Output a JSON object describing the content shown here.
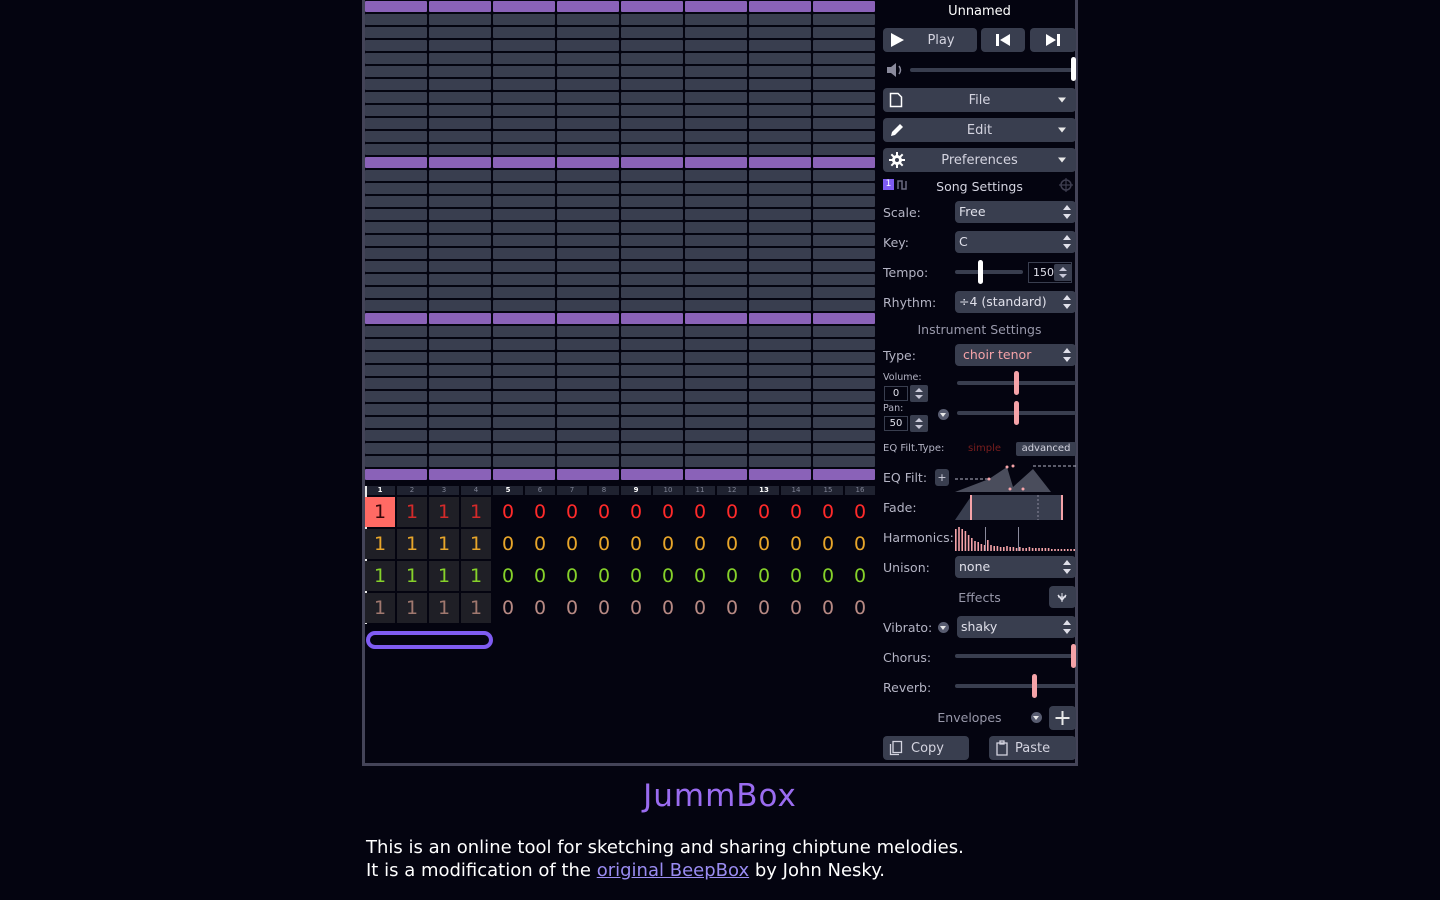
{
  "song": {
    "title": "Unnamed"
  },
  "transport": {
    "play_label": "Play",
    "volume": 1.0
  },
  "menus": {
    "file_label": "File",
    "edit_label": "Edit",
    "preferences_label": "Preferences"
  },
  "song_settings": {
    "heading": "Song Settings",
    "channel_number": "1",
    "scale_label": "Scale:",
    "scale_value": "Free",
    "key_label": "Key:",
    "key_value": "C",
    "tempo_label": "Tempo:",
    "tempo_value": "150",
    "tempo_level": 0.22,
    "rhythm_label": "Rhythm:",
    "rhythm_value": "÷4 (standard)"
  },
  "instrument_settings": {
    "heading": "Instrument Settings",
    "type_label": "Type:",
    "type_value": "choir tenor",
    "volume_label": "Volume:",
    "volume_value": "0",
    "volume_level": 0.5,
    "pan_label": "Pan:",
    "pan_value": "50",
    "pan_level": 0.5,
    "eq_type_label": "EQ Filt.Type:",
    "eq_type_simple": "simple",
    "eq_type_advanced": "advanced",
    "eq_filt_label": "EQ Filt:",
    "eq_add_label": "+",
    "fade_label": "Fade:",
    "harmonics_label": "Harmonics:",
    "unison_label": "Unison:",
    "unison_value": "none",
    "effects_heading": "Effects",
    "vibrato_label": "Vibrato:",
    "vibrato_value": "shaky",
    "chorus_label": "Chorus:",
    "chorus_level": 1.0,
    "reverb_label": "Reverb:",
    "reverb_level": 0.66,
    "envelopes_heading": "Envelopes",
    "copy_label": "Copy",
    "paste_label": "Paste"
  },
  "ruler": {
    "bars": [
      "1",
      "2",
      "3",
      "4",
      "5",
      "6",
      "7",
      "8",
      "9",
      "10",
      "11",
      "12",
      "13",
      "14",
      "15",
      "16"
    ],
    "major": [
      "1",
      "5",
      "9",
      "13"
    ]
  },
  "patterns": {
    "channels": [
      {
        "color": "#ff2a2a",
        "dim": "#8f1b1b",
        "cells": [
          "1",
          "1",
          "1",
          "1",
          "0",
          "0",
          "0",
          "0",
          "0",
          "0",
          "0",
          "0",
          "0",
          "0",
          "0",
          "0"
        ]
      },
      {
        "color": "#e8a62a",
        "dim": "#8a6520",
        "cells": [
          "1",
          "1",
          "1",
          "1",
          "0",
          "0",
          "0",
          "0",
          "0",
          "0",
          "0",
          "0",
          "0",
          "0",
          "0",
          "0"
        ]
      },
      {
        "color": "#86d22a",
        "dim": "#4f7f1d",
        "cells": [
          "1",
          "1",
          "1",
          "1",
          "0",
          "0",
          "0",
          "0",
          "0",
          "0",
          "0",
          "0",
          "0",
          "0",
          "0",
          "0"
        ]
      },
      {
        "color": "#b88a84",
        "dim": "#6e5552",
        "cells": [
          "1",
          "1",
          "1",
          "1",
          "0",
          "0",
          "0",
          "0",
          "0",
          "0",
          "0",
          "0",
          "0",
          "0",
          "0",
          "0"
        ]
      }
    ]
  },
  "footer": {
    "brand": "JummBox",
    "line1": "This is an online tool for sketching and sharing chiptune melodies.",
    "line2_pre": "It is a modification of the ",
    "link": "original BeepBox",
    "line2_post": " by John Nesky."
  },
  "colors": {
    "accent": "#9a6cf0",
    "octave_row": "#8a62b8",
    "note_row": "#393e4f",
    "selected_pattern": "#ff6a64"
  }
}
